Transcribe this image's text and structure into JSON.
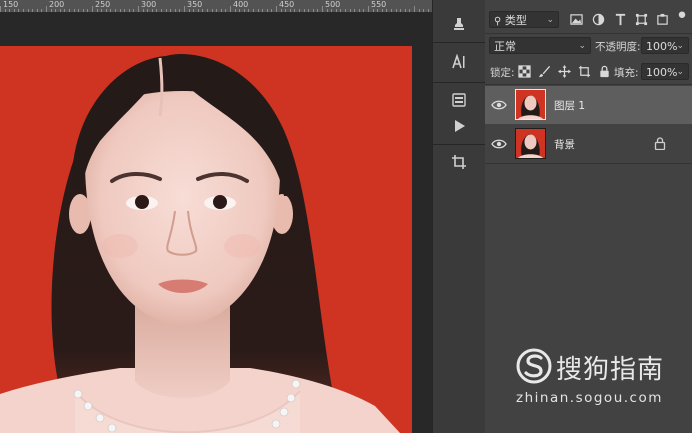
{
  "ruler": {
    "labels": [
      "150",
      "200",
      "250",
      "300",
      "350",
      "400",
      "450",
      "500",
      "550"
    ]
  },
  "toolbar": {
    "tools": [
      {
        "icon": "stamp-icon"
      },
      {
        "icon": "character-panel-icon"
      },
      {
        "icon": "properties-icon"
      },
      {
        "icon": "play-icon"
      },
      {
        "icon": "crop-icon"
      }
    ]
  },
  "layers_panel": {
    "filter_label": "类型",
    "blend_mode": "正常",
    "opacity_label": "不透明度:",
    "opacity_value": "100%",
    "lock_label": "锁定:",
    "fill_label": "填充:",
    "fill_value": "100%",
    "layers": [
      {
        "name": "图层 1",
        "selected": true,
        "visible": true,
        "locked": false
      },
      {
        "name": "背景",
        "selected": false,
        "visible": true,
        "locked": true
      }
    ]
  },
  "watermark": {
    "brand": "搜狗指南",
    "url": "zhinan.sogou.com"
  },
  "colors": {
    "photo_background": "#cf3422",
    "panel": "#424242",
    "selected_layer": "#5e5e5e"
  }
}
